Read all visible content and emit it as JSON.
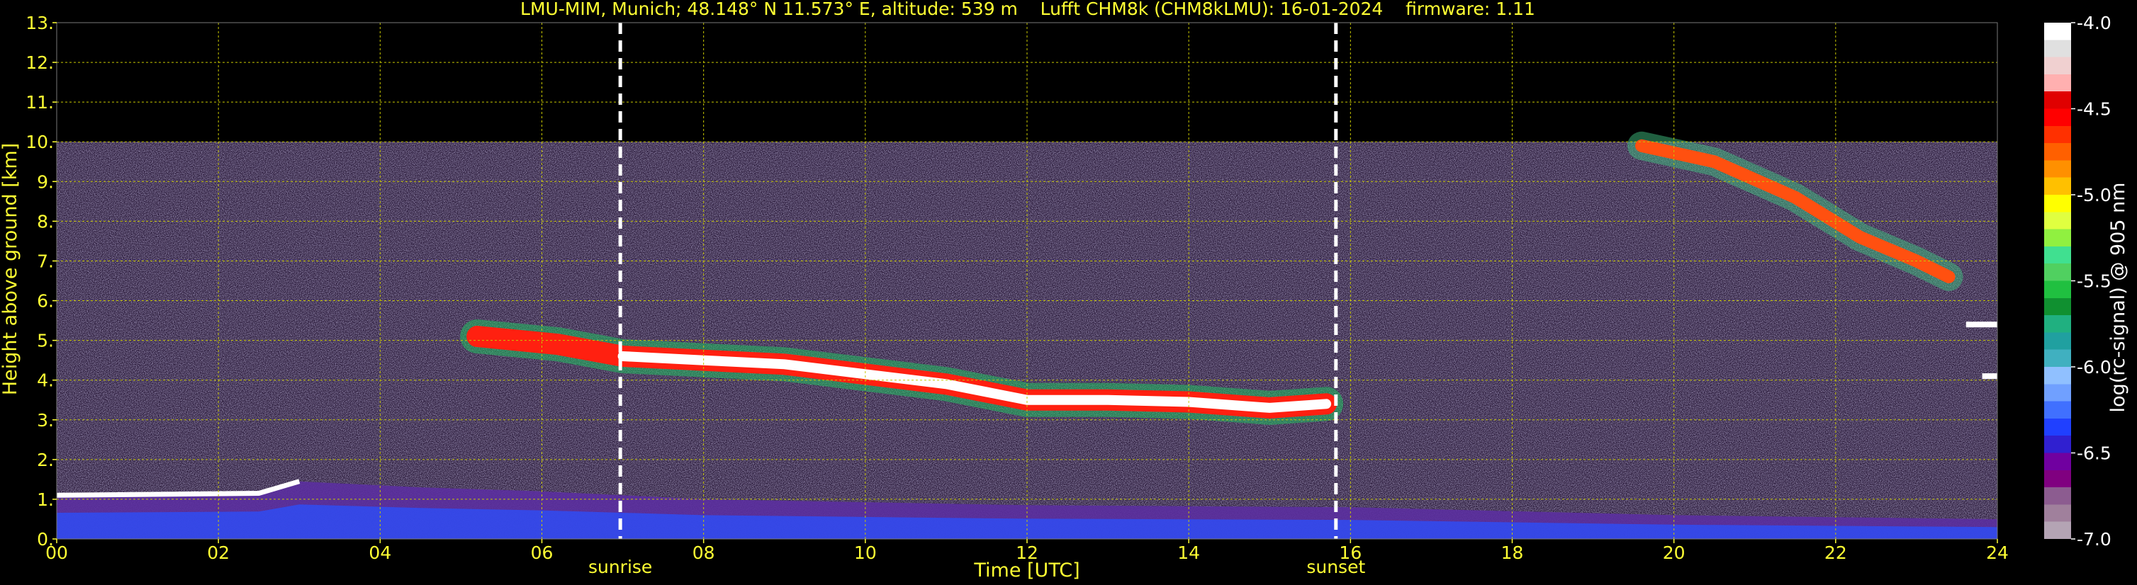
{
  "title": "LMU-MIM, Munich; 48.148° N 11.573° E, altitude: 539 m    Lufft CHM8k (CHM8kLMU): 16-01-2024    firmware: 1.11",
  "chart_data": {
    "type": "heatmap",
    "xlabel": "Time [UTC]",
    "ylabel": "Height above ground [km]",
    "xlim": [
      0,
      24
    ],
    "ylim": [
      0,
      13
    ],
    "x_ticks": [
      "00",
      "02",
      "04",
      "06",
      "08",
      "10",
      "12",
      "14",
      "16",
      "18",
      "20",
      "22",
      "24"
    ],
    "y_ticks": [
      "0.",
      "1.",
      "2.",
      "3.",
      "4.",
      "5.",
      "6.",
      "7.",
      "8.",
      "9.",
      "10.",
      "11.",
      "12.",
      "13."
    ],
    "grid": true,
    "data_max_height_km": 10,
    "events": [
      {
        "label": "sunrise",
        "time": 6.97
      },
      {
        "label": "sunset",
        "time": 15.82
      }
    ],
    "colorbar": {
      "label": "log(rc-signal) @ 905 nm",
      "ticks": [
        "-4.0",
        "-4.5",
        "-5.0",
        "-5.5",
        "-6.0",
        "-6.5",
        "-7.0"
      ],
      "range": [
        -7.0,
        -4.0
      ],
      "colors": [
        "#b4a4b4",
        "#a0809c",
        "#8c5c90",
        "#800080",
        "#7000a0",
        "#3020d0",
        "#2040ff",
        "#4070ff",
        "#70a0ff",
        "#90c0ff",
        "#40b0c0",
        "#20a0a0",
        "#20b080",
        "#109030",
        "#20c040",
        "#50d060",
        "#40e090",
        "#90f040",
        "#e0ff40",
        "#ffff00",
        "#ffc000",
        "#ff9000",
        "#ff6000",
        "#ff3000",
        "#ff0000",
        "#e00000",
        "#ffb0b0",
        "#f0d0d0",
        "#e0e0e0",
        "#ffffff"
      ]
    },
    "layers": [
      {
        "name": "aerosol_layer",
        "points": [
          [
            0,
            1.1
          ],
          [
            2.5,
            1.15
          ],
          [
            3,
            1.45
          ],
          [
            4.5,
            1.3
          ],
          [
            6,
            1.2
          ],
          [
            8,
            1.0
          ],
          [
            12,
            0.85
          ],
          [
            16,
            0.8
          ],
          [
            20,
            0.6
          ],
          [
            24,
            0.5
          ]
        ]
      },
      {
        "name": "cloud_layer_mid",
        "points": [
          [
            5.2,
            5.1
          ],
          [
            6.2,
            4.9
          ],
          [
            7,
            4.6
          ],
          [
            8,
            4.5
          ],
          [
            9,
            4.4
          ],
          [
            10,
            4.15
          ],
          [
            11,
            3.9
          ],
          [
            12,
            3.5
          ],
          [
            13,
            3.5
          ],
          [
            14,
            3.45
          ],
          [
            15,
            3.3
          ],
          [
            15.7,
            3.4
          ]
        ]
      },
      {
        "name": "cloud_layer_high",
        "points": [
          [
            19.6,
            9.9
          ],
          [
            20.5,
            9.5
          ],
          [
            21.5,
            8.6
          ],
          [
            22.3,
            7.6
          ],
          [
            23,
            7.0
          ],
          [
            23.4,
            6.6
          ]
        ]
      },
      {
        "name": "cloud_fragments_right",
        "points": [
          [
            23.7,
            5.4
          ],
          [
            23.9,
            4.1
          ]
        ]
      }
    ]
  }
}
